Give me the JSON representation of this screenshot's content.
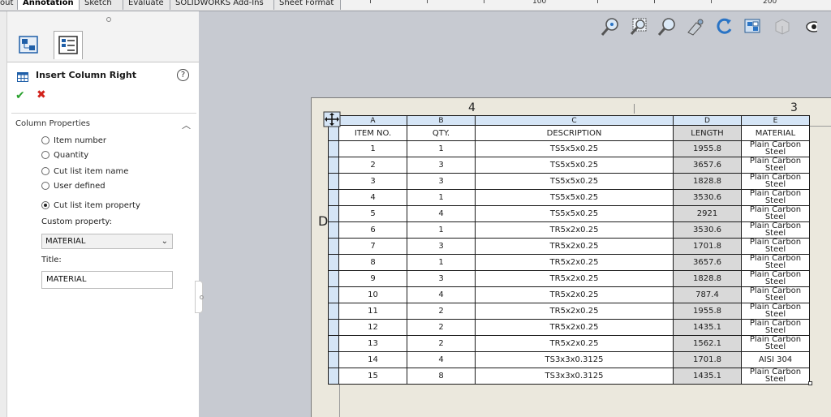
{
  "tabs": [
    "out",
    "Annotation",
    "Sketch",
    "Evaluate",
    "SOLIDWORKS Add-Ins",
    "Sheet Format"
  ],
  "active_tab": "Annotation",
  "ruler": {
    "labels": [
      "100",
      "200"
    ]
  },
  "panel": {
    "title": "Insert Column Right",
    "help_label": "?",
    "section_title": "Column Properties",
    "radios": [
      {
        "label": "Item number",
        "selected": false
      },
      {
        "label": "Quantity",
        "selected": false
      },
      {
        "label": "Cut list item name",
        "selected": false
      },
      {
        "label": "User defined",
        "selected": false
      },
      {
        "label": "Cut list item property",
        "selected": true
      }
    ],
    "custom_property_label": "Custom property:",
    "custom_property_value": "MATERIAL",
    "title_label": "Title:",
    "title_value": "MATERIAL"
  },
  "sheet": {
    "zone_top_left": "4",
    "zone_top_right": "3",
    "zone_left": "D"
  },
  "table": {
    "column_letters": [
      "A",
      "B",
      "C",
      "D",
      "E"
    ],
    "headers": [
      "ITEM NO.",
      "QTY.",
      "DESCRIPTION",
      "LENGTH",
      "MATERIAL"
    ],
    "rows": [
      [
        "1",
        "1",
        "TS5x5x0.25",
        "1955.8",
        "Plain Carbon Steel"
      ],
      [
        "2",
        "3",
        "TS5x5x0.25",
        "3657.6",
        "Plain Carbon Steel"
      ],
      [
        "3",
        "3",
        "TS5x5x0.25",
        "1828.8",
        "Plain Carbon Steel"
      ],
      [
        "4",
        "1",
        "TS5x5x0.25",
        "3530.6",
        "Plain Carbon Steel"
      ],
      [
        "5",
        "4",
        "TS5x5x0.25",
        "2921",
        "Plain Carbon Steel"
      ],
      [
        "6",
        "1",
        "TR5x2x0.25",
        "3530.6",
        "Plain Carbon Steel"
      ],
      [
        "7",
        "3",
        "TR5x2x0.25",
        "1701.8",
        "Plain Carbon Steel"
      ],
      [
        "8",
        "1",
        "TR5x2x0.25",
        "3657.6",
        "Plain Carbon Steel"
      ],
      [
        "9",
        "3",
        "TR5x2x0.25",
        "1828.8",
        "Plain Carbon Steel"
      ],
      [
        "10",
        "4",
        "TR5x2x0.25",
        "787.4",
        "Plain Carbon Steel"
      ],
      [
        "11",
        "2",
        "TR5x2x0.25",
        "1955.8",
        "Plain Carbon Steel"
      ],
      [
        "12",
        "2",
        "TR5x2x0.25",
        "1435.1",
        "Plain Carbon Steel"
      ],
      [
        "13",
        "2",
        "TR5x2x0.25",
        "1562.1",
        "Plain Carbon Steel"
      ],
      [
        "14",
        "4",
        "TS3x3x0.3125",
        "1701.8",
        "AISI 304"
      ],
      [
        "15",
        "8",
        "TS3x3x0.3125",
        "1435.1",
        "Plain Carbon Steel"
      ]
    ]
  },
  "icons": {
    "toolbar": [
      "zoom-to-fit-icon",
      "zoom-to-area-icon",
      "zoom-in-out-icon",
      "pan-icon",
      "rotate-icon",
      "view-orientation-icon",
      "display-style-icon",
      "hide-show-icon"
    ],
    "panel": [
      "table-icon",
      "help-icon",
      "ok-check-icon",
      "cancel-x-icon",
      "feature-manager-icon",
      "property-manager-icon"
    ]
  },
  "colors": {
    "header_blue": "#d5e5f6",
    "ok_green": "#2aa12e",
    "cancel_red": "#d2221b",
    "sheet_bg": "#ebe8dd",
    "canvas_bg": "#c7cad1"
  }
}
